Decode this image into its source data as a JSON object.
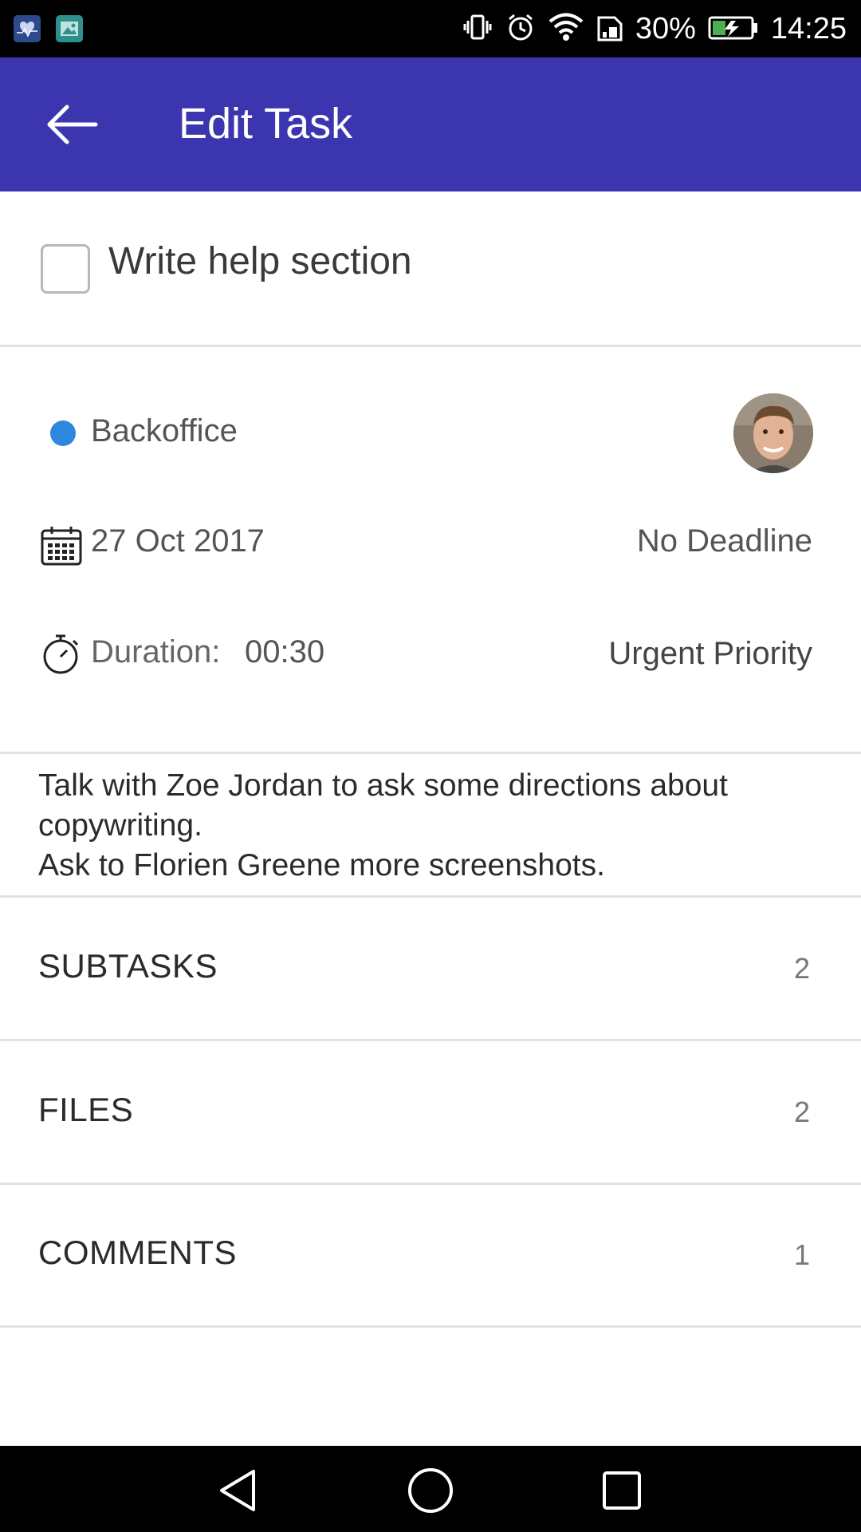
{
  "status_bar": {
    "battery_percent": "30%",
    "time": "14:25"
  },
  "app_bar": {
    "title": "Edit Task"
  },
  "task": {
    "title": "Write help section",
    "completed": false
  },
  "details": {
    "project": "Backoffice",
    "project_color": "#2e86de",
    "date": "27 Oct 2017",
    "deadline": "No Deadline",
    "duration_label": "Duration:",
    "duration_value": "00:30",
    "priority": "Urgent Priority"
  },
  "description": {
    "lines": [
      "Talk with Zoe Jordan to ask some directions about",
      "copywriting.",
      "Ask to Florien Greene more screenshots."
    ]
  },
  "sections": [
    {
      "label": "SUBTASKS",
      "count": "2"
    },
    {
      "label": "FILES",
      "count": "2"
    },
    {
      "label": "COMMENTS",
      "count": "1"
    }
  ],
  "colors": {
    "accent": "#3b36b0",
    "status_bar": "#000000"
  }
}
